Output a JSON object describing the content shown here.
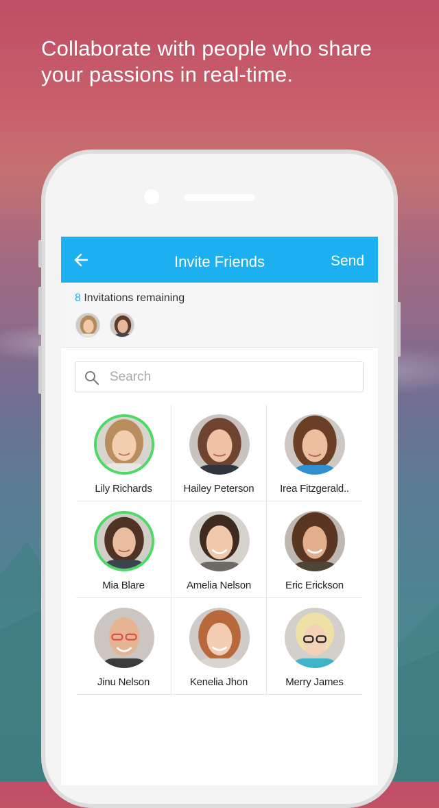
{
  "headline": "Collaborate with people who share your passions in real-time.",
  "colors": {
    "accent": "#1cb0f0",
    "selected_ring": "#4cd964",
    "count_text": "#1cb0f0"
  },
  "appbar": {
    "back_icon": "arrow-left-icon",
    "title": "Invite Friends",
    "send_label": "Send"
  },
  "invitations": {
    "count": "8",
    "label": " Invitations remaining",
    "selected_avatars": [
      "Lily Richards",
      "Mia Blare"
    ]
  },
  "search": {
    "icon": "search-icon",
    "placeholder": "Search",
    "value": ""
  },
  "contacts": [
    {
      "name": "Lily Richards",
      "selected": true
    },
    {
      "name": "Hailey Peterson",
      "selected": false
    },
    {
      "name": "Irea Fitzgerald..",
      "selected": false
    },
    {
      "name": "Mia Blare",
      "selected": true
    },
    {
      "name": "Amelia Nelson",
      "selected": false
    },
    {
      "name": "Eric Erickson",
      "selected": false
    },
    {
      "name": "Jinu Nelson",
      "selected": false
    },
    {
      "name": "Kenelia Jhon",
      "selected": false
    },
    {
      "name": "Merry James",
      "selected": false
    }
  ]
}
